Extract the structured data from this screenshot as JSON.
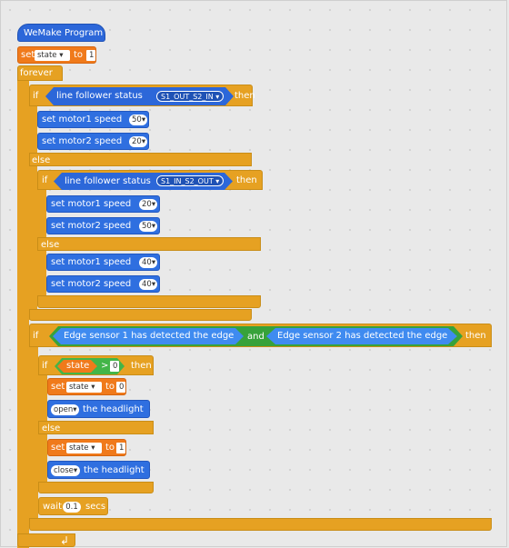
{
  "hat": {
    "label": "WeMake Program"
  },
  "set_state_1": {
    "set": "set",
    "var": "state ▾",
    "to": "to",
    "value": "1"
  },
  "forever": {
    "label": "forever"
  },
  "if1": {
    "if": "if",
    "sensor": "line follower status",
    "status": "S1_OUT_S2_IN ▾",
    "then": "then",
    "m1": {
      "label": "set motor1 speed",
      "value": "50▾"
    },
    "m2": {
      "label": "set motor2 speed",
      "value": "20▾"
    },
    "else": "else"
  },
  "if2": {
    "if": "if",
    "sensor": "line follower status",
    "status": "S1_IN_S2_OUT ▾",
    "then": "then",
    "m1": {
      "label": "set motor1 speed",
      "value": "20▾"
    },
    "m2": {
      "label": "set motor2 speed",
      "value": "50▾"
    },
    "else": "else",
    "e1": {
      "label": "set motor1 speed",
      "value": "40▾"
    },
    "e2": {
      "label": "set motor2 speed",
      "value": "40▾"
    }
  },
  "if3": {
    "if": "if",
    "cond1": "Edge sensor  1  has  detected  the  edge",
    "and": "and",
    "cond2": "Edge sensor  2  has  detected  the  edge",
    "then": "then"
  },
  "if4": {
    "if": "if",
    "var": "state",
    "op": ">",
    "num": "0",
    "then": "then",
    "set_a": {
      "set": "set",
      "var": "state ▾",
      "to": "to",
      "value": "0"
    },
    "light_a": {
      "option": "open▾",
      "label": "the  headlight"
    },
    "else": "else",
    "set_b": {
      "set": "set",
      "var": "state ▾",
      "to": "to",
      "value": "1"
    },
    "light_b": {
      "option": "close▾",
      "label": "the  headlight"
    }
  },
  "wait": {
    "label": "wait",
    "value": "0.1",
    "unit": "secs"
  },
  "loop_arrow": "↲",
  "colors": {
    "control": "#e6a122",
    "motor": "#2f6fe0",
    "variable": "#f07a1b",
    "operator": "#43b548",
    "sensor": "#2c67d9"
  }
}
